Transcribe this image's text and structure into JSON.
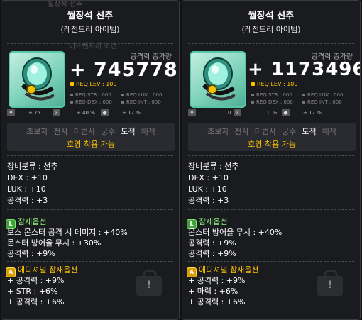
{
  "tooltips": [
    {
      "title": "월장석 선추",
      "rarity": "(레전드리 아이템)",
      "ghost_top": "월장석 선추",
      "ghost_mid": "어드벤처리 조건",
      "attack_label": "공격력 증가량",
      "attack_value": "+ 745778",
      "req_lev": "REQ LEV : 100",
      "req": {
        "str": "REQ STR : 000",
        "luk": "REQ LUK : 000",
        "dex": "REQ DEX : 000",
        "int": "REQ INT : 000"
      },
      "stat_bar": {
        "a": "+ 75",
        "b": "+ 40 %",
        "c": "+ 12 %"
      },
      "classes": [
        "초보자",
        "전사",
        "마법사",
        "궁수",
        "도적",
        "해적"
      ],
      "active_class_index": 4,
      "equip_note": "호영 착용 가능",
      "attributes": [
        "장비분류 : 선추",
        "DEX : +10",
        "LUK : +10",
        "공격력 : +3"
      ],
      "potential": {
        "badge": "L",
        "title": "잠재옵션",
        "lines": [
          "보스 몬스터 공격 시 데미지 : +40%",
          "몬스터 방어율 무시 : +30%",
          "공격력 : +9%"
        ]
      },
      "additional": {
        "badge": "A",
        "title": "에디셔널 잠재옵션",
        "lines": [
          "+ 공격력 : +9%",
          "+ STR : +6%",
          "+ 공격력 : +6%"
        ]
      },
      "lock_glyph": "!"
    },
    {
      "title": "월장석 선추",
      "rarity": "(레전드리 아이템)",
      "ghost_top": "",
      "ghost_mid": "",
      "attack_label": "공격력 증가량",
      "attack_value": "+ 1173496",
      "req_lev": "REQ LEV : 100",
      "req": {
        "str": "REQ STR : 000",
        "luk": "REQ LUK : 000",
        "dex": "REQ DEX : 000",
        "int": "REQ INT : 000"
      },
      "stat_bar": {
        "a": "0",
        "b": "0 %",
        "c": "+ 17 %"
      },
      "classes": [
        "초보자",
        "전사",
        "마법사",
        "궁수",
        "도적",
        "해적"
      ],
      "active_class_index": 4,
      "equip_note": "호영 착용 가능",
      "attributes": [
        "장비분류 : 선추",
        "DEX : +10",
        "LUK : +10",
        "공격력 : +3"
      ],
      "potential": {
        "badge": "L",
        "title": "잠재옵션",
        "lines": [
          "몬스터 방어율 무시 : +40%",
          "공격력 : +9%",
          "공격력 : +9%"
        ]
      },
      "additional": {
        "badge": "A",
        "title": "에디셔널 잠재옵션",
        "lines": [
          "+ 공격력 : +9%",
          "+ 마력 : +6%",
          "+ 공격력 : +6%"
        ]
      },
      "lock_glyph": "!"
    }
  ],
  "colors": {
    "potential_green": "#3ea13b",
    "potential_title": "#8df07a",
    "additional_gold": "#ffc400",
    "background": "#1a1b1f"
  }
}
